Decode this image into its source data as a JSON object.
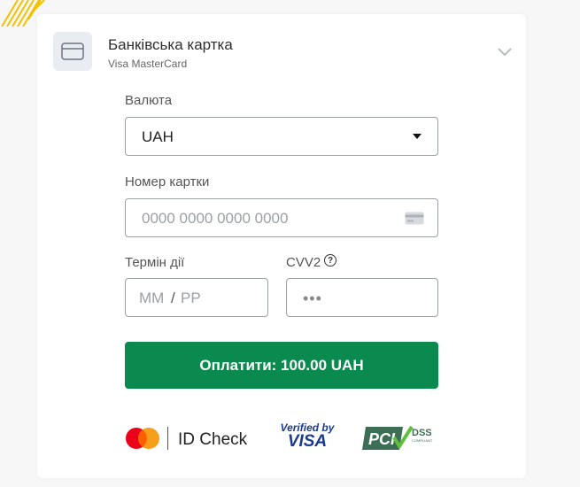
{
  "header": {
    "title": "Банківська картка",
    "subtitle": "Visa MasterCard",
    "icon": "credit-card-icon"
  },
  "form": {
    "currency": {
      "label": "Валюта",
      "value": "UAH"
    },
    "card_number": {
      "label": "Номер картки",
      "placeholder": "0000 0000 0000 0000"
    },
    "expiry": {
      "label": "Термін дії",
      "placeholder_month": "MM",
      "separator": "/",
      "placeholder_year": "PP"
    },
    "cvv": {
      "label": "CVV2",
      "placeholder": "•••"
    }
  },
  "pay_button": {
    "label": "Оплатити: 100.00 UAH"
  },
  "footer_logos": {
    "mastercard_idcheck": "ID Check",
    "verified_by_visa_line1": "Verified by",
    "verified_by_visa_line2": "VISA",
    "pci_dss": "PCI DSS"
  },
  "colors": {
    "accent": "#0a8a4f",
    "card_bg": "#ffffff",
    "page_bg": "#f7f7f7",
    "icon_bg": "#e9edf2"
  }
}
